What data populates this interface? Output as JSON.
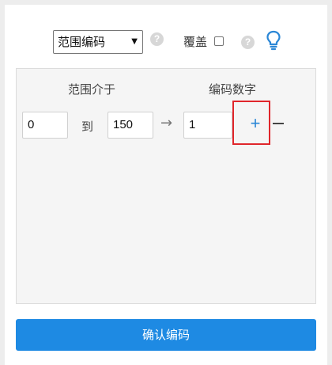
{
  "toolbar": {
    "mode_select_value": "范围编码",
    "help_glyph": "?",
    "overwrite_label": "覆盖",
    "overwrite_checked": false
  },
  "panel": {
    "header_range": "范围介于",
    "header_number": "编码数字",
    "range_from": "0",
    "range_to_label": "到",
    "range_to": "150",
    "arrow": "→",
    "start_number": "1",
    "add_label": "+"
  },
  "footer": {
    "confirm_label": "确认编码"
  },
  "colors": {
    "accent": "#1e8ae3",
    "highlight": "#e0262b",
    "bulb": "#2b87d6"
  },
  "icons": [
    "help-icon",
    "lightbulb-icon",
    "arrow-right-icon",
    "plus-icon",
    "minus-icon",
    "dropdown-caret-icon"
  ]
}
